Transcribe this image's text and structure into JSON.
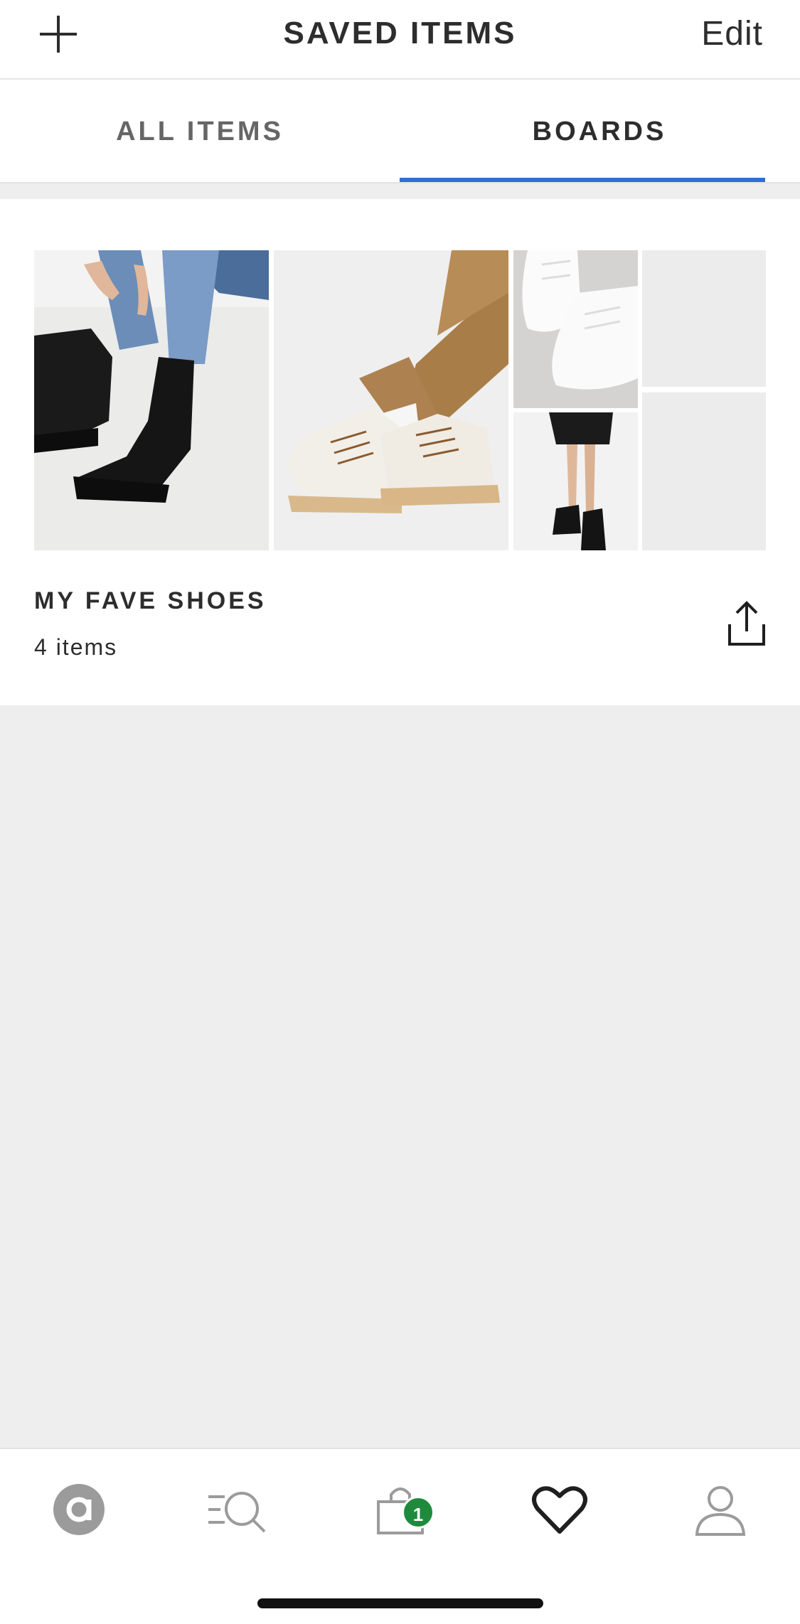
{
  "header": {
    "title": "SAVED ITEMS",
    "edit_label": "Edit",
    "add_icon": "plus-icon"
  },
  "tabs": [
    {
      "label": "ALL ITEMS",
      "active": false
    },
    {
      "label": "BOARDS",
      "active": true
    }
  ],
  "accent_color": "#2f6fd2",
  "board": {
    "name": "MY FAVE SHOES",
    "count": "4 items",
    "share_icon": "share-icon",
    "images": [
      "black-chelsea-boots-photo",
      "white-hiker-boots-photo",
      "white-sneakers-photo",
      "black-lace-up-boots-photo",
      "empty-placeholder",
      "empty-placeholder"
    ]
  },
  "bottom_nav": {
    "items": [
      {
        "name": "home",
        "icon": "asos-logo-icon"
      },
      {
        "name": "search",
        "icon": "search-icon"
      },
      {
        "name": "bag",
        "icon": "bag-icon",
        "badge": "1"
      },
      {
        "name": "saved",
        "icon": "heart-icon",
        "active": true
      },
      {
        "name": "account",
        "icon": "user-icon"
      }
    ],
    "badge_color": "#1f8a3c"
  }
}
